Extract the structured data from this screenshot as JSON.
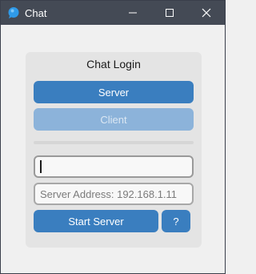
{
  "window": {
    "title": "Chat",
    "icon": "chat-bubble-icon",
    "controls": [
      "minimize-icon",
      "maximize-icon",
      "close-icon"
    ]
  },
  "login": {
    "title": "Chat Login",
    "server_button": "Server",
    "client_button": "Client",
    "name_input": {
      "value": "",
      "placeholder": ""
    },
    "address_input": {
      "value": "",
      "placeholder": "Server Address: 192.168.1.11"
    },
    "start_button": "Start Server",
    "help_button": "?"
  },
  "colors": {
    "titlebar": "#444a55",
    "accent": "#3a7ebf",
    "accent_disabled": "#8cb3da",
    "panel": "#e4e4e4"
  }
}
